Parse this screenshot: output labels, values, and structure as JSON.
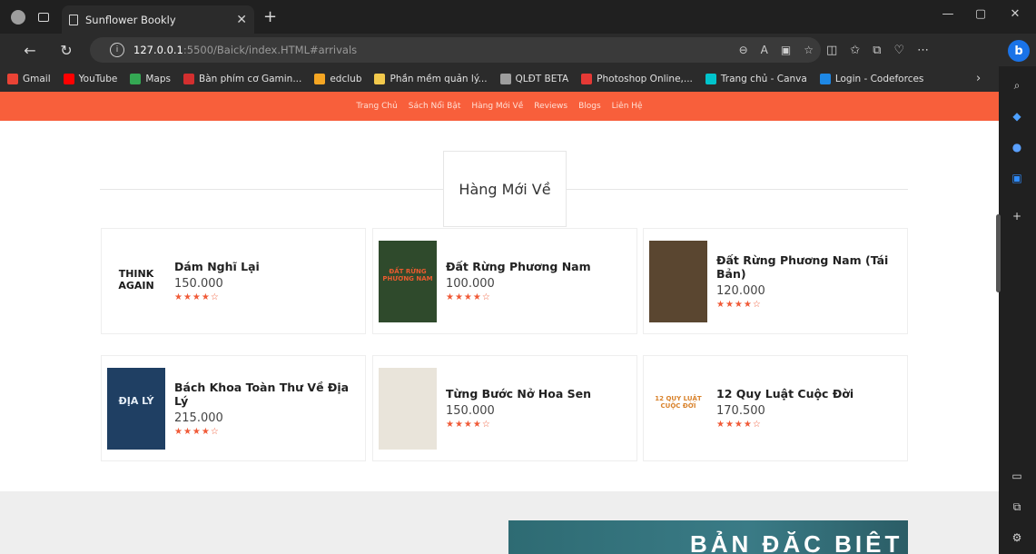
{
  "browser": {
    "tab_title": "Sunflower Bookly",
    "url_host": "127.0.0.1",
    "url_path": ":5500/Baick/index.HTML#arrivals",
    "favorites": [
      {
        "label": "Gmail",
        "color": "#ea4335"
      },
      {
        "label": "YouTube",
        "color": "#ff0000"
      },
      {
        "label": "Maps",
        "color": "#34a853"
      },
      {
        "label": "Bàn phím cơ Gamin...",
        "color": "#d32f2f"
      },
      {
        "label": "edclub",
        "color": "#f5a623"
      },
      {
        "label": "Phần mềm quản lý...",
        "color": "#f2c94c"
      },
      {
        "label": "QLĐT BETA",
        "color": "#9e9e9e"
      },
      {
        "label": "Photoshop Online,...",
        "color": "#e53935"
      },
      {
        "label": "Trang chủ - Canva",
        "color": "#00c4cc"
      },
      {
        "label": "Login - Codeforces",
        "color": "#1e88e5"
      }
    ],
    "bing_letter": "b"
  },
  "site": {
    "nav": [
      "Trang Chủ",
      "Sách Nổi Bật",
      "Hàng Mới Về",
      "Reviews",
      "Blogs",
      "Liên Hệ"
    ],
    "section_title": "Hàng Mới Về",
    "books": [
      {
        "name": "Dám Nghĩ Lại",
        "price": "150.000",
        "stars": "★★★★☆",
        "cover_text": "THINK AGAIN",
        "cover_bg": "#ffffff",
        "cover_fg": "#1a1a1a"
      },
      {
        "name": "Đất Rừng Phương Nam",
        "price": "100.000",
        "stars": "★★★★☆",
        "cover_text": "ĐẤT RỪNG PHƯƠNG NAM",
        "cover_bg": "#2f4a2c",
        "cover_fg": "#e95b2f"
      },
      {
        "name": "Đất Rừng Phương Nam (Tái Bản)",
        "price": "120.000",
        "stars": "★★★★☆",
        "cover_text": "",
        "cover_bg": "#5a4630",
        "cover_fg": "#f0e0c0"
      },
      {
        "name": "Bách Khoa Toàn Thư Về Địa Lý",
        "price": "215.000",
        "stars": "★★★★☆",
        "cover_text": "ĐỊA LÝ",
        "cover_bg": "#1f3f63",
        "cover_fg": "#e6eef7"
      },
      {
        "name": "Từng Bước Nở Hoa Sen",
        "price": "150.000",
        "stars": "★★★★☆",
        "cover_text": "",
        "cover_bg": "#e9e4da",
        "cover_fg": "#3a3a3a"
      },
      {
        "name": "12 Quy Luật Cuộc Đời",
        "price": "170.500",
        "stars": "★★★★☆",
        "cover_text": "12 QUY LUẬT CUỘC ĐỜI",
        "cover_bg": "#ffffff",
        "cover_fg": "#d9822b"
      }
    ],
    "banner_text": "BẢN ĐẶC BIỆT"
  },
  "colors": {
    "accent": "#f85f3b",
    "star": "#f05a37"
  }
}
